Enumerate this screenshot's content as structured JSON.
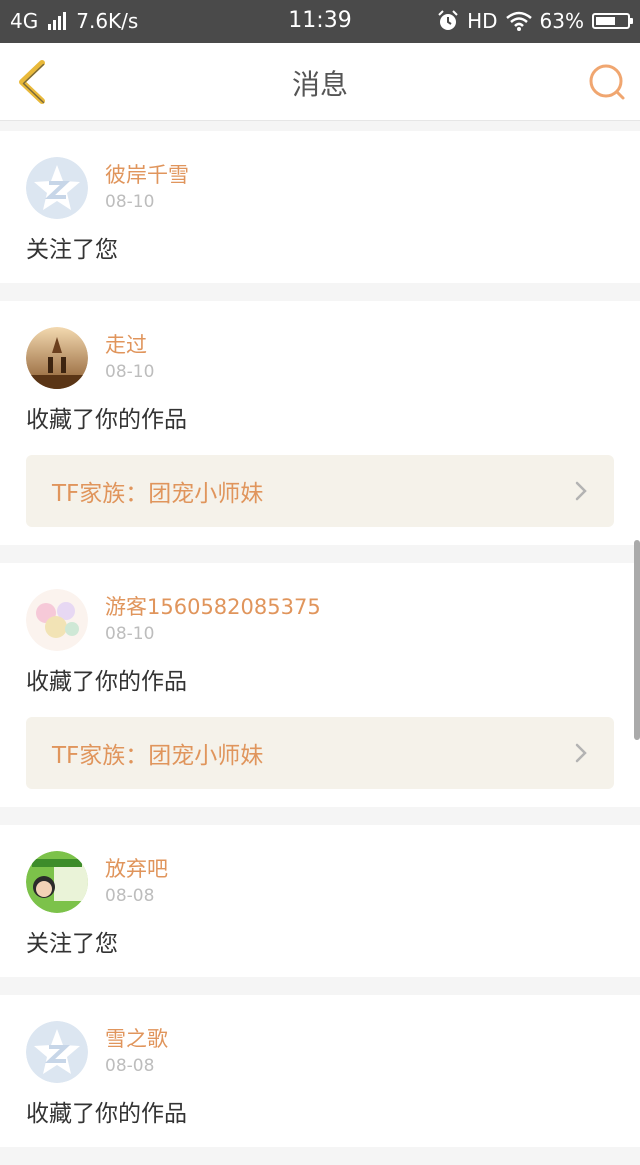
{
  "status_bar": {
    "network": "4G",
    "speed": "7.6K/s",
    "time": "11:39",
    "hd": "HD",
    "battery": "63%",
    "battery_level": 0.63
  },
  "header": {
    "title": "消息"
  },
  "messages": [
    {
      "username": "彼岸千雪",
      "date": "08-10",
      "action": "关注了您",
      "avatar": "qzone-default-avatar"
    },
    {
      "username": "走过",
      "date": "08-10",
      "action": "收藏了你的作品",
      "work_title": "TF家族：团宠小师妹",
      "avatar": "photo-avatar"
    },
    {
      "username": "游客1560582085375",
      "date": "08-10",
      "action": "收藏了你的作品",
      "work_title": "TF家族：团宠小师妹",
      "avatar": "anime-avatar"
    },
    {
      "username": "放弃吧",
      "date": "08-08",
      "action": "关注了您",
      "avatar": "photo-avatar"
    },
    {
      "username": "雪之歌",
      "date": "08-08",
      "action": "收藏了你的作品",
      "avatar": "qzone-default-avatar"
    }
  ]
}
